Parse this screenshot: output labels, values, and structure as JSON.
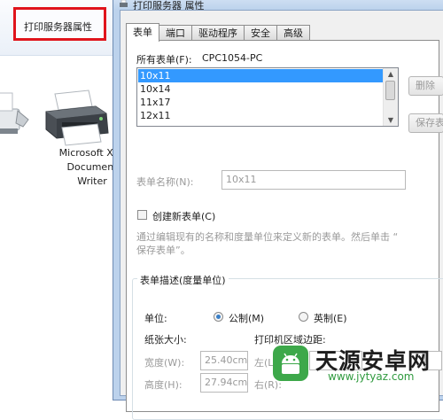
{
  "explorer": {
    "toolbar_label": "打印服务器属性",
    "printer_name_lines": [
      "Microsoft XPS",
      "Document",
      "Writer"
    ]
  },
  "dialog": {
    "title": "打印服务器 属性",
    "tabs": [
      "表单",
      "端口",
      "驱动程序",
      "安全",
      "高级"
    ],
    "active_tab": "表单",
    "forms_on_label": "所有表单(F):",
    "server_name": "CPC1054-PC",
    "forms_list": [
      "10x11",
      "10x14",
      "11x17",
      "12x11"
    ],
    "selected_form": "10x11",
    "delete_button": "删除",
    "save_button": "保存表",
    "form_name_label": "表单名称(N):",
    "form_name_value": "10x11",
    "create_new_label": "创建新表单(C)",
    "description_lines": [
      "通过编辑现有的名称和度量单位来定义新的表单。然后单击 “",
      "保存表单”。"
    ],
    "group_title": "表单描述(度量单位)",
    "units_label": "单位:",
    "units_metric": "公制(M)",
    "units_english": "英制(E)",
    "paper_size_label": "纸张大小:",
    "margins_label": "打印机区域边距:",
    "width_label": "宽度(W):",
    "width_value": "25.40cm",
    "height_label": "高度(H):",
    "height_value": "27.94cm",
    "left_label": "左(L):",
    "right_label": "右(R):",
    "selected_unit": "metric"
  },
  "watermark": {
    "name": "天源安卓网",
    "url": "www.jytyaz.com"
  },
  "colors": {
    "highlight": "#e0141c",
    "selection": "#3399ff",
    "dialog_frame": "#bcd2ec",
    "watermark_green": "#3da84a"
  }
}
